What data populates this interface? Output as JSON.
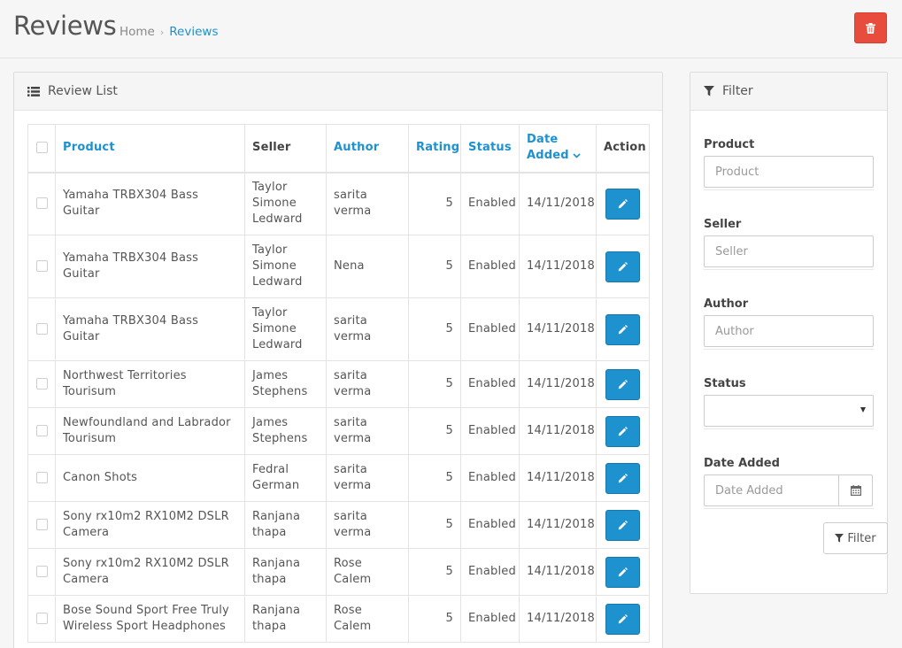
{
  "header": {
    "title": "Reviews",
    "breadcrumb": [
      {
        "label": "Home"
      },
      {
        "label": "Reviews"
      }
    ],
    "delete_icon": "trash-icon",
    "colors": {
      "danger": "#e74c3c",
      "primary": "#1e91cf"
    }
  },
  "list_panel": {
    "title": "Review List",
    "icon": "list-icon",
    "columns": {
      "product": "Product",
      "seller": "Seller",
      "author": "Author",
      "rating": "Rating",
      "status": "Status",
      "date_added": "Date Added",
      "action": "Action"
    },
    "rows": [
      {
        "product": "Yamaha TRBX304 Bass Guitar",
        "seller": "Taylor Simone Ledward",
        "author": "sarita verma",
        "rating": "5",
        "status": "Enabled",
        "date_added": "14/11/2018"
      },
      {
        "product": "Yamaha TRBX304 Bass Guitar",
        "seller": "Taylor Simone Ledward",
        "author": "Nena",
        "rating": "5",
        "status": "Enabled",
        "date_added": "14/11/2018"
      },
      {
        "product": "Yamaha TRBX304 Bass Guitar",
        "seller": "Taylor Simone Ledward",
        "author": "sarita verma",
        "rating": "5",
        "status": "Enabled",
        "date_added": "14/11/2018"
      },
      {
        "product": "Northwest Territories Tourisum",
        "seller": "James Stephens",
        "author": "sarita verma",
        "rating": "5",
        "status": "Enabled",
        "date_added": "14/11/2018"
      },
      {
        "product": "Newfoundland and Labrador Tourisum",
        "seller": "James Stephens",
        "author": "sarita verma",
        "rating": "5",
        "status": "Enabled",
        "date_added": "14/11/2018"
      },
      {
        "product": "Canon Shots",
        "seller": "Fedral German",
        "author": "sarita verma",
        "rating": "5",
        "status": "Enabled",
        "date_added": "14/11/2018"
      },
      {
        "product": "Sony rx10m2 RX10M2 DSLR Camera",
        "seller": "Ranjana thapa",
        "author": "sarita verma",
        "rating": "5",
        "status": "Enabled",
        "date_added": "14/11/2018"
      },
      {
        "product": "Sony rx10m2 RX10M2 DSLR Camera",
        "seller": "Ranjana thapa",
        "author": "Rose Calem",
        "rating": "5",
        "status": "Enabled",
        "date_added": "14/11/2018"
      },
      {
        "product": "Bose Sound Sport Free Truly Wireless Sport Headphones",
        "seller": "Ranjana thapa",
        "author": "Rose Calem",
        "rating": "5",
        "status": "Enabled",
        "date_added": "14/11/2018"
      }
    ],
    "row_heights": [
      71,
      71,
      71,
      53,
      53,
      53,
      53,
      53,
      53
    ]
  },
  "filter_panel": {
    "title": "Filter",
    "icon": "filter-icon",
    "fields": {
      "product": {
        "label": "Product",
        "placeholder": "Product"
      },
      "seller": {
        "label": "Seller",
        "placeholder": "Seller"
      },
      "author": {
        "label": "Author",
        "placeholder": "Author"
      },
      "status": {
        "label": "Status",
        "value": ""
      },
      "date_added": {
        "label": "Date Added",
        "placeholder": "Date Added"
      }
    },
    "button_label": "Filter"
  }
}
